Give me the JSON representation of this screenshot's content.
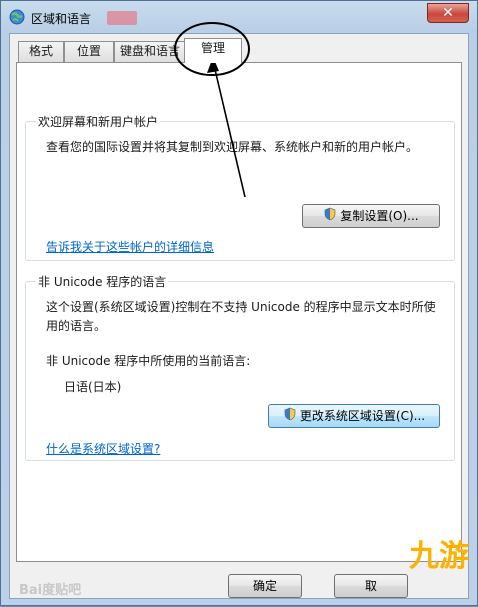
{
  "window": {
    "title": "区域和语言",
    "close_glyph": "✕"
  },
  "tabs": [
    {
      "label": "格式"
    },
    {
      "label": "位置"
    },
    {
      "label": "键盘和语言"
    },
    {
      "label": "管理",
      "active": true
    }
  ],
  "welcome_group": {
    "title": "欢迎屏幕和新用户帐户",
    "description": "查看您的国际设置并将其复制到欢迎屏幕、系统帐户和新的用户帐户。",
    "copy_button": "复制设置(O)...",
    "link": "告诉我关于这些帐户的详细信息"
  },
  "unicode_group": {
    "title": "非 Unicode 程序的语言",
    "description_line1": "这个设置(系统区域设置)控制在不支持 Unicode 的程序中显示文本时所使",
    "description_line2": "用的语言。",
    "current_label": "非 Unicode 程序中所使用的当前语言:",
    "current_value": "日语(日本)",
    "change_button": "更改系统区域设置(C)...",
    "link": "什么是系统区域设置?"
  },
  "footer": {
    "ok_button": "确定",
    "cancel_button": "取"
  },
  "overlay": {
    "watermark": "Bai度贴吧",
    "brand": "九游"
  },
  "colors": {
    "link": "#0066cc",
    "annotation": "#000000",
    "close_button": "#c9493b"
  },
  "icons": [
    "globe-icon",
    "close-icon",
    "uac-shield-icon"
  ]
}
